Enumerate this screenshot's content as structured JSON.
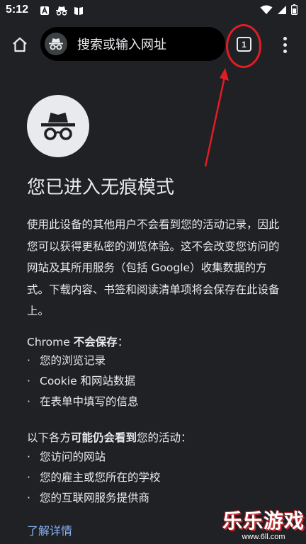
{
  "status_bar": {
    "time": "5:12"
  },
  "toolbar": {
    "omnibox_text": "搜索或输入网址",
    "tab_count": "1"
  },
  "content": {
    "title": "您已进入无痕模式",
    "intro": "使用此设备的其他用户不会看到您的活动记录，因此您可以获得更私密的浏览体验。这不会改变您访问的网站及其所用服务（包括 Google）收集数据的方式。下载内容、书签和阅读清单项将会保存在此设备上。",
    "not_saved": {
      "prefix": "Chrome ",
      "bold": "不会保存",
      "suffix": "：",
      "items": [
        "您的浏览记录",
        "Cookie 和网站数据",
        "在表单中填写的信息"
      ]
    },
    "may_see": {
      "prefix": "以下各方",
      "bold": "可能仍会看到",
      "suffix": "您的活动：",
      "items": [
        "您访问的网站",
        "您的雇主或您所在的学校",
        "您的互联网服务提供商"
      ]
    },
    "learn_more": "了解详情"
  },
  "watermark": {
    "main": "乐乐游戏",
    "sub": "www.6ll.com"
  },
  "colors": {
    "background": "#202124",
    "text": "#e8eaed",
    "link": "#8ab4f8",
    "annotation": "#e11d24"
  }
}
